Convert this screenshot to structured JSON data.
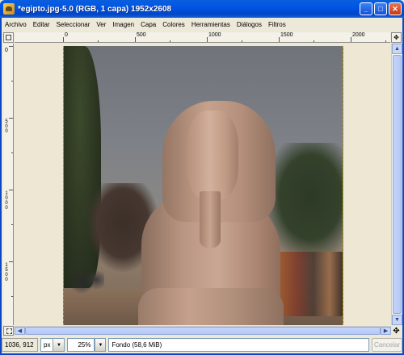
{
  "window": {
    "title": "*egipto.jpg-5.0 (RGB, 1 capa) 1952x2608",
    "minimize_label": "_",
    "maximize_label": "□",
    "close_label": "✕"
  },
  "menubar": {
    "items": [
      "Archivo",
      "Editar",
      "Seleccionar",
      "Ver",
      "Imagen",
      "Capa",
      "Colores",
      "Herramientas",
      "Diálogos",
      "Filtros"
    ]
  },
  "ruler_horizontal": {
    "labels": [
      "0",
      "500",
      "1000",
      "1500",
      "2000"
    ]
  },
  "ruler_vertical": {
    "labels": [
      "0",
      "500",
      "1000",
      "1500"
    ]
  },
  "canvas": {
    "image_name": "egipto.jpg",
    "icons": [
      "navigate-icon",
      "quickmask-icon",
      "move-icon"
    ]
  },
  "statusbar": {
    "coordinates": "1036, 912",
    "unit": "px",
    "zoom": "25%",
    "message": "Fondo (58,6 MiB)",
    "cancel_label": "Cancelar"
  }
}
